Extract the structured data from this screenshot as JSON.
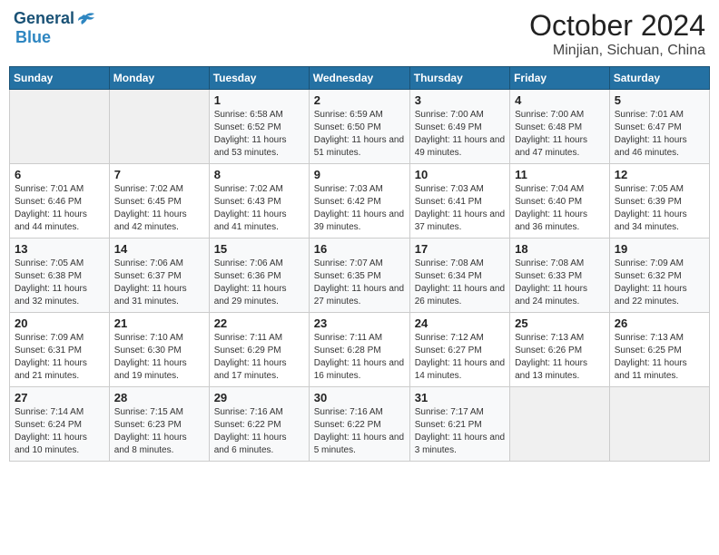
{
  "header": {
    "logo_line1": "General",
    "logo_line2": "Blue",
    "title": "October 2024",
    "subtitle": "Minjian, Sichuan, China"
  },
  "weekdays": [
    "Sunday",
    "Monday",
    "Tuesday",
    "Wednesday",
    "Thursday",
    "Friday",
    "Saturday"
  ],
  "weeks": [
    [
      {
        "day": "",
        "info": ""
      },
      {
        "day": "",
        "info": ""
      },
      {
        "day": "1",
        "info": "Sunrise: 6:58 AM\nSunset: 6:52 PM\nDaylight: 11 hours and 53 minutes."
      },
      {
        "day": "2",
        "info": "Sunrise: 6:59 AM\nSunset: 6:50 PM\nDaylight: 11 hours and 51 minutes."
      },
      {
        "day": "3",
        "info": "Sunrise: 7:00 AM\nSunset: 6:49 PM\nDaylight: 11 hours and 49 minutes."
      },
      {
        "day": "4",
        "info": "Sunrise: 7:00 AM\nSunset: 6:48 PM\nDaylight: 11 hours and 47 minutes."
      },
      {
        "day": "5",
        "info": "Sunrise: 7:01 AM\nSunset: 6:47 PM\nDaylight: 11 hours and 46 minutes."
      }
    ],
    [
      {
        "day": "6",
        "info": "Sunrise: 7:01 AM\nSunset: 6:46 PM\nDaylight: 11 hours and 44 minutes."
      },
      {
        "day": "7",
        "info": "Sunrise: 7:02 AM\nSunset: 6:45 PM\nDaylight: 11 hours and 42 minutes."
      },
      {
        "day": "8",
        "info": "Sunrise: 7:02 AM\nSunset: 6:43 PM\nDaylight: 11 hours and 41 minutes."
      },
      {
        "day": "9",
        "info": "Sunrise: 7:03 AM\nSunset: 6:42 PM\nDaylight: 11 hours and 39 minutes."
      },
      {
        "day": "10",
        "info": "Sunrise: 7:03 AM\nSunset: 6:41 PM\nDaylight: 11 hours and 37 minutes."
      },
      {
        "day": "11",
        "info": "Sunrise: 7:04 AM\nSunset: 6:40 PM\nDaylight: 11 hours and 36 minutes."
      },
      {
        "day": "12",
        "info": "Sunrise: 7:05 AM\nSunset: 6:39 PM\nDaylight: 11 hours and 34 minutes."
      }
    ],
    [
      {
        "day": "13",
        "info": "Sunrise: 7:05 AM\nSunset: 6:38 PM\nDaylight: 11 hours and 32 minutes."
      },
      {
        "day": "14",
        "info": "Sunrise: 7:06 AM\nSunset: 6:37 PM\nDaylight: 11 hours and 31 minutes."
      },
      {
        "day": "15",
        "info": "Sunrise: 7:06 AM\nSunset: 6:36 PM\nDaylight: 11 hours and 29 minutes."
      },
      {
        "day": "16",
        "info": "Sunrise: 7:07 AM\nSunset: 6:35 PM\nDaylight: 11 hours and 27 minutes."
      },
      {
        "day": "17",
        "info": "Sunrise: 7:08 AM\nSunset: 6:34 PM\nDaylight: 11 hours and 26 minutes."
      },
      {
        "day": "18",
        "info": "Sunrise: 7:08 AM\nSunset: 6:33 PM\nDaylight: 11 hours and 24 minutes."
      },
      {
        "day": "19",
        "info": "Sunrise: 7:09 AM\nSunset: 6:32 PM\nDaylight: 11 hours and 22 minutes."
      }
    ],
    [
      {
        "day": "20",
        "info": "Sunrise: 7:09 AM\nSunset: 6:31 PM\nDaylight: 11 hours and 21 minutes."
      },
      {
        "day": "21",
        "info": "Sunrise: 7:10 AM\nSunset: 6:30 PM\nDaylight: 11 hours and 19 minutes."
      },
      {
        "day": "22",
        "info": "Sunrise: 7:11 AM\nSunset: 6:29 PM\nDaylight: 11 hours and 17 minutes."
      },
      {
        "day": "23",
        "info": "Sunrise: 7:11 AM\nSunset: 6:28 PM\nDaylight: 11 hours and 16 minutes."
      },
      {
        "day": "24",
        "info": "Sunrise: 7:12 AM\nSunset: 6:27 PM\nDaylight: 11 hours and 14 minutes."
      },
      {
        "day": "25",
        "info": "Sunrise: 7:13 AM\nSunset: 6:26 PM\nDaylight: 11 hours and 13 minutes."
      },
      {
        "day": "26",
        "info": "Sunrise: 7:13 AM\nSunset: 6:25 PM\nDaylight: 11 hours and 11 minutes."
      }
    ],
    [
      {
        "day": "27",
        "info": "Sunrise: 7:14 AM\nSunset: 6:24 PM\nDaylight: 11 hours and 10 minutes."
      },
      {
        "day": "28",
        "info": "Sunrise: 7:15 AM\nSunset: 6:23 PM\nDaylight: 11 hours and 8 minutes."
      },
      {
        "day": "29",
        "info": "Sunrise: 7:16 AM\nSunset: 6:22 PM\nDaylight: 11 hours and 6 minutes."
      },
      {
        "day": "30",
        "info": "Sunrise: 7:16 AM\nSunset: 6:22 PM\nDaylight: 11 hours and 5 minutes."
      },
      {
        "day": "31",
        "info": "Sunrise: 7:17 AM\nSunset: 6:21 PM\nDaylight: 11 hours and 3 minutes."
      },
      {
        "day": "",
        "info": ""
      },
      {
        "day": "",
        "info": ""
      }
    ]
  ]
}
